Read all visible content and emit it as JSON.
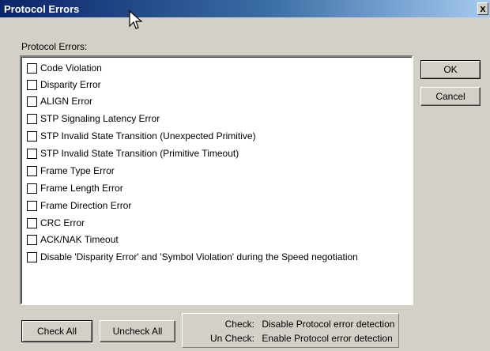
{
  "window": {
    "title": "Protocol Errors",
    "close_glyph": "x"
  },
  "group_label": "Protocol Errors:",
  "items": [
    {
      "label": "Code Violation",
      "checked": false
    },
    {
      "label": "Disparity Error",
      "checked": false
    },
    {
      "label": "ALIGN Error",
      "checked": false
    },
    {
      "label": "STP Signaling Latency Error",
      "checked": false
    },
    {
      "label": "STP Invalid State Transition (Unexpected Primitive)",
      "checked": false
    },
    {
      "label": "STP Invalid State Transition (Primitive Timeout)",
      "checked": false
    },
    {
      "label": "Frame Type Error",
      "checked": false
    },
    {
      "label": "Frame Length Error",
      "checked": false
    },
    {
      "label": "Frame Direction Error",
      "checked": false
    },
    {
      "label": "CRC Error",
      "checked": false
    },
    {
      "label": "ACK/NAK Timeout",
      "checked": false
    },
    {
      "label": "Disable 'Disparity Error' and 'Symbol Violation' during the Speed negotiation",
      "checked": false
    }
  ],
  "buttons": {
    "ok": "OK",
    "cancel": "Cancel",
    "check_all": "Check All",
    "uncheck_all": "Uncheck All"
  },
  "info": {
    "check_key": "Check:",
    "check_text": "Disable Protocol error detection",
    "uncheck_key": "Un Check:",
    "uncheck_text": "Enable Protocol error detection"
  }
}
